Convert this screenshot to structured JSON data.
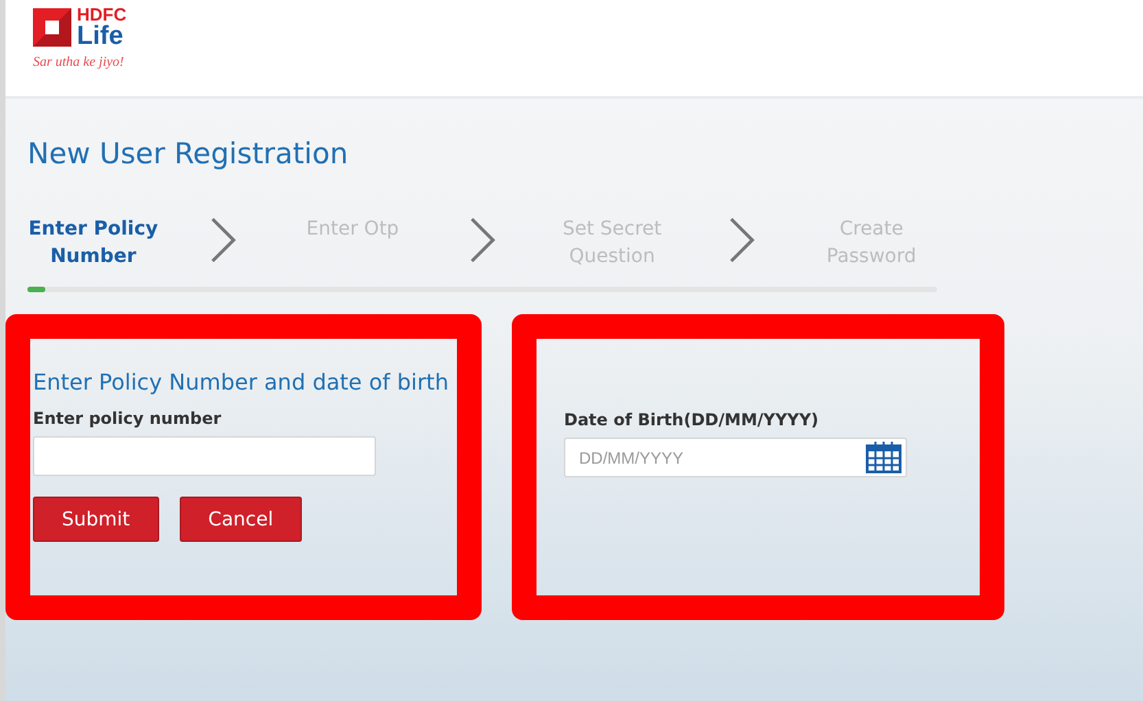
{
  "logo": {
    "brand": "HDFC",
    "name": "Life",
    "tagline": "Sar utha ke jiyo!"
  },
  "page_title": "New User Registration",
  "steps": [
    {
      "label": "Enter Policy Number",
      "selected": true
    },
    {
      "label": "Enter Otp",
      "selected": false
    },
    {
      "label": "Set Secret Question",
      "selected": false
    },
    {
      "label": "Create Password",
      "selected": false
    }
  ],
  "progress": {
    "level": 0.02
  },
  "panels": [
    {
      "highlighted": true,
      "heading": "Enter Policy Number and date of birth",
      "field": {
        "label": "Enter policy number",
        "kind": "text"
      },
      "buttons": [
        "Submit",
        "Cancel"
      ]
    },
    {
      "highlighted": true,
      "field": {
        "label": "Date of Birth(DD/MM/YYYY)",
        "placeholder": "DD/MM/YYYY",
        "kind": "date"
      }
    }
  ]
}
